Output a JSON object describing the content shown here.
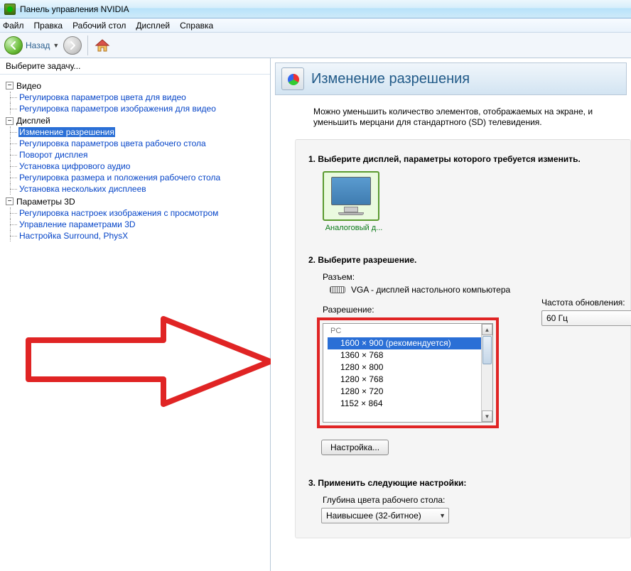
{
  "window": {
    "title": "Панель управления NVIDIA"
  },
  "menu": {
    "file": "Файл",
    "edit": "Правка",
    "desktop": "Рабочий стол",
    "display": "Дисплей",
    "help": "Справка"
  },
  "toolbar": {
    "back": "Назад"
  },
  "left": {
    "header": "Выберите задачу...",
    "groups": [
      {
        "label": "Видео",
        "items": [
          "Регулировка параметров цвета для видео",
          "Регулировка параметров изображения для видео"
        ],
        "selected": -1
      },
      {
        "label": "Дисплей",
        "items": [
          "Изменение разрешения",
          "Регулировка параметров цвета рабочего стола",
          "Поворот дисплея",
          "Установка цифрового аудио",
          "Регулировка размера и положения рабочего стола",
          "Установка нескольких дисплеев"
        ],
        "selected": 0
      },
      {
        "label": "Параметры 3D",
        "items": [
          "Регулировка настроек изображения с просмотром",
          "Управление параметрами 3D",
          "Настройка Surround, PhysX"
        ],
        "selected": -1
      }
    ]
  },
  "page": {
    "title": "Изменение разрешения",
    "desc": "Можно уменьшить количество элементов, отображаемых на экране, и уменьшить мерцани для стандартного (SD) телевидения.",
    "step1": "1. Выберите дисплей, параметры которого требуется изменить.",
    "monitor_label": "Аналоговый д...",
    "step2": "2. Выберите разрешение.",
    "connector_label": "Разъем:",
    "connector_value": "VGA - дисплей настольного компьютера",
    "resolution_label": "Разрешение:",
    "resolution_group": "PC",
    "resolutions": [
      "1600 × 900 (рекомендуется)",
      "1360 × 768",
      "1280 × 800",
      "1280 × 768",
      "1280 × 720",
      "1152 × 864"
    ],
    "resolution_selected": 0,
    "refresh_label": "Частота обновления:",
    "refresh_value": "60 Гц",
    "customize_btn": "Настройка...",
    "step3": "3. Применить следующие настройки:",
    "color_depth_label": "Глубина цвета рабочего стола:",
    "color_depth_value": "Наивысшее (32-битное)"
  }
}
